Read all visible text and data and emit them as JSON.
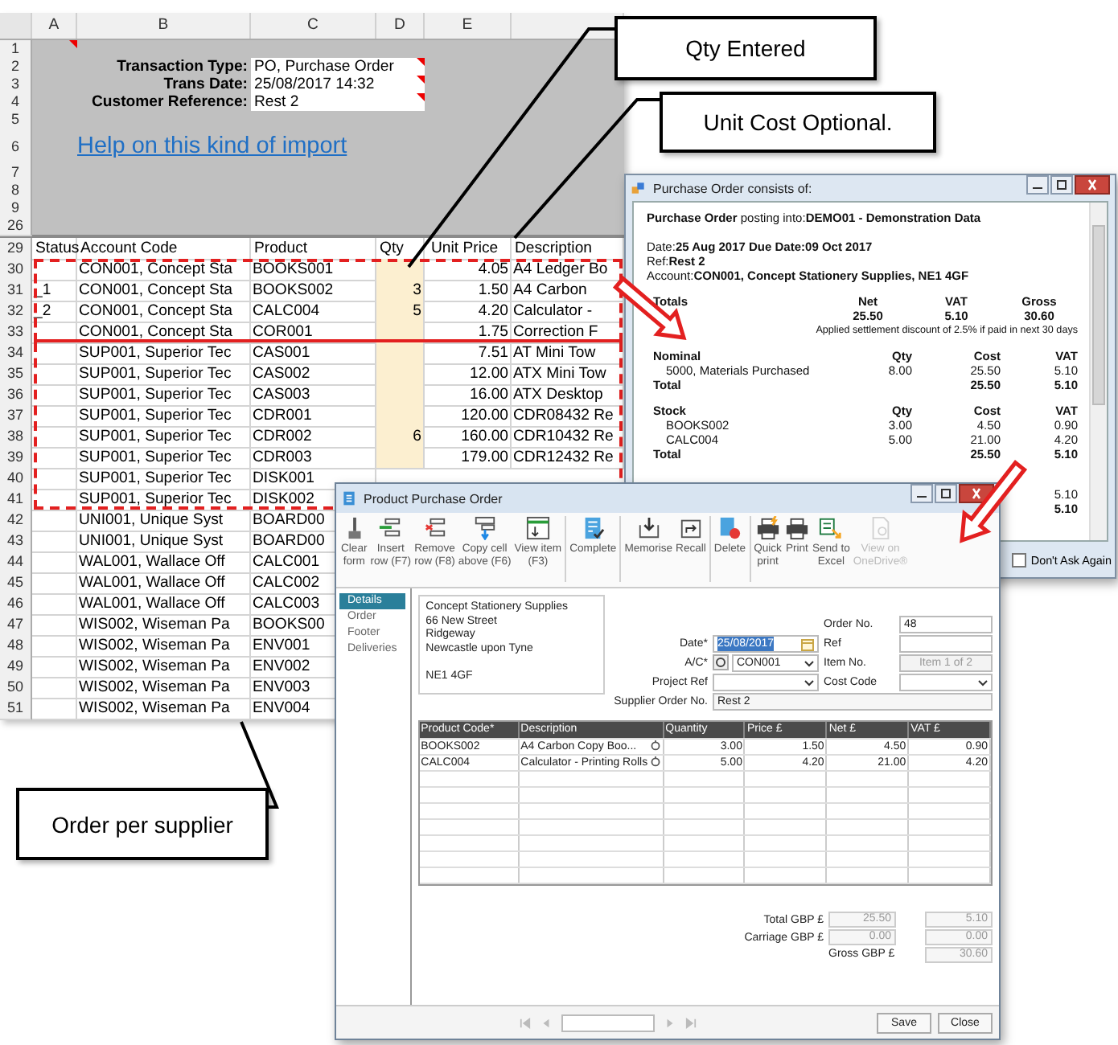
{
  "callouts": [
    "Qty Entered",
    "Unit Cost Optional.",
    "Order per supplier"
  ],
  "spreadsheet": {
    "columns": [
      "A",
      "B",
      "C",
      "D",
      "E"
    ],
    "top_rows": [
      {
        "number": "1",
        "comment": true
      },
      {
        "number": "2",
        "label": "Transaction Type:",
        "value": "PO, Purchase Order",
        "comment": true
      },
      {
        "number": "3",
        "label": "Trans Date:",
        "value": "25/08/2017 14:32",
        "comment": true
      },
      {
        "number": "4",
        "label": "Customer Reference:",
        "value": "Rest 2",
        "comment": true
      },
      {
        "number": "5"
      },
      {
        "number": "6",
        "link": "Help on this kind of import"
      },
      {
        "number": "7"
      },
      {
        "number": "8"
      },
      {
        "number": "9"
      },
      {
        "number": "26"
      }
    ],
    "header_row": {
      "number": "29",
      "cells": [
        "Status",
        "Account Code",
        "Product",
        "Qty",
        "Unit Price",
        "Description"
      ]
    },
    "rows": [
      {
        "number": "30",
        "account": "CON001, Concept Sta",
        "product": "BOOKS001",
        "unit_price": "4.05",
        "description": "A4 Ledger Bo"
      },
      {
        "number": "31",
        "status": "_1",
        "account": "CON001, Concept Sta",
        "product": "BOOKS002",
        "qty": "3",
        "unit_price": "1.50",
        "description": "A4 Carbon"
      },
      {
        "number": "32",
        "status": "_2",
        "account": "CON001, Concept Sta",
        "product": "CALC004",
        "qty": "5",
        "unit_price": "4.20",
        "description": "Calculator -"
      },
      {
        "number": "33",
        "account": "CON001, Concept Sta",
        "product": "COR001",
        "unit_price": "1.75",
        "description": "Correction F"
      },
      {
        "number": "34",
        "account": "SUP001, Superior Tec",
        "product": "CAS001",
        "unit_price": "7.51",
        "description": "AT Mini Tow"
      },
      {
        "number": "35",
        "account": "SUP001, Superior Tec",
        "product": "CAS002",
        "unit_price": "12.00",
        "description": "ATX Mini Tow"
      },
      {
        "number": "36",
        "account": "SUP001, Superior Tec",
        "product": "CAS003",
        "unit_price": "16.00",
        "description": "ATX Desktop"
      },
      {
        "number": "37",
        "account": "SUP001, Superior Tec",
        "product": "CDR001",
        "unit_price": "120.00",
        "description": "CDR08432 Re"
      },
      {
        "number": "38",
        "account": "SUP001, Superior Tec",
        "product": "CDR002",
        "qty": "6",
        "unit_price": "160.00",
        "description": "CDR10432 Re"
      },
      {
        "number": "39",
        "account": "SUP001, Superior Tec",
        "product": "CDR003",
        "unit_price": "179.00",
        "description": "CDR12432 Re"
      },
      {
        "number": "40",
        "account": "SUP001, Superior Tec",
        "product": "DISK001"
      },
      {
        "number": "41",
        "account": "SUP001, Superior Tec",
        "product": "DISK002"
      },
      {
        "number": "42",
        "account": "UNI001, Unique Syst",
        "product": "BOARD00"
      },
      {
        "number": "43",
        "account": "UNI001, Unique Syst",
        "product": "BOARD00"
      },
      {
        "number": "44",
        "account": "WAL001, Wallace Off",
        "product": "CALC001"
      },
      {
        "number": "45",
        "account": "WAL001, Wallace Off",
        "product": "CALC002"
      },
      {
        "number": "46",
        "account": "WAL001, Wallace Off",
        "product": "CALC003"
      },
      {
        "number": "47",
        "account": "WIS002, Wiseman Pa",
        "product": "BOOKS00"
      },
      {
        "number": "48",
        "account": "WIS002, Wiseman Pa",
        "product": "ENV001"
      },
      {
        "number": "49",
        "account": "WIS002, Wiseman Pa",
        "product": "ENV002"
      },
      {
        "number": "50",
        "account": "WIS002, Wiseman Pa",
        "product": "ENV003"
      },
      {
        "number": "51",
        "account": "WIS002, Wiseman Pa",
        "product": "ENV004"
      }
    ]
  },
  "po_dialog": {
    "title": "Purchase Order consists of:",
    "heading": "**Purchase Order** posting into:**DEMO01 - Demonstration Data**",
    "date_line": "Date:**25 Aug 2017 Due Date:09 Oct 2017**",
    "ref_line": "Ref:**Rest 2**",
    "account_line": "Account:**CON001, Concept Stationery Supplies, NE1 4GF**",
    "totals": {
      "label": "Totals",
      "headers": [
        "Net",
        "VAT",
        "Gross"
      ],
      "values": [
        "25.50",
        "5.10",
        "30.60"
      ],
      "note": "Applied settlement discount of 2.5% if paid in next 30 days"
    },
    "sections": [
      {
        "title": "Nominal",
        "headers": [
          "Qty",
          "Cost",
          "VAT"
        ],
        "rows": [
          {
            "name": "5000, Materials Purchased",
            "qty": "8.00",
            "cost": "25.50",
            "vat": "5.10"
          }
        ],
        "total": {
          "label": "Total",
          "cost": "25.50",
          "vat": "5.10"
        }
      },
      {
        "title": "Stock",
        "headers": [
          "Qty",
          "Cost",
          "VAT"
        ],
        "rows": [
          {
            "name": "BOOKS002",
            "qty": "3.00",
            "cost": "4.50",
            "vat": "0.90"
          },
          {
            "name": "CALC004",
            "qty": "5.00",
            "cost": "21.00",
            "vat": "4.20"
          }
        ],
        "total": {
          "label": "Total",
          "cost": "25.50",
          "vat": "5.10"
        }
      },
      {
        "rows": [
          {
            "vat": "5.10"
          }
        ],
        "total": {
          "vat": "5.10"
        }
      }
    ],
    "dont_ask_again": {
      "label": "Don't Ask Again",
      "checked": false
    }
  },
  "product_window": {
    "title": "Product Purchase Order",
    "toolbar_groups": [
      [
        {
          "lines": [
            "Clear",
            "form"
          ],
          "disabled": false
        },
        {
          "lines": [
            "Insert",
            "row (F7)"
          ],
          "disabled": false
        },
        {
          "lines": [
            "Remove",
            "row (F8)"
          ],
          "disabled": false
        },
        {
          "lines": [
            "Copy cell",
            "above (F6)"
          ],
          "disabled": false
        },
        {
          "lines": [
            "View item",
            "(F3)"
          ],
          "disabled": false
        }
      ],
      [
        {
          "lines": [
            "Complete"
          ],
          "disabled": false
        }
      ],
      [
        {
          "lines": [
            "Memorise"
          ],
          "disabled": false
        },
        {
          "lines": [
            "Recall"
          ],
          "disabled": false
        }
      ],
      [
        {
          "lines": [
            "Delete"
          ],
          "disabled": false
        }
      ],
      [
        {
          "lines": [
            "Quick",
            "print"
          ],
          "disabled": false
        },
        {
          "lines": [
            "Print"
          ],
          "disabled": false
        },
        {
          "lines": [
            "Send to",
            "Excel"
          ],
          "disabled": false
        },
        {
          "lines": [
            "View on",
            "OneDrive®"
          ],
          "disabled": true
        }
      ]
    ],
    "nav": [
      {
        "label": "Details",
        "selected": true
      },
      {
        "label": "Order",
        "selected": false
      },
      {
        "label": "Footer",
        "selected": false
      },
      {
        "label": "Deliveries",
        "selected": false
      }
    ],
    "address": [
      "Concept Stationery Supplies",
      "66 New Street",
      "Ridgeway",
      "Newcastle upon Tyne"
    ],
    "postcode": "NE1 4GF",
    "form": {
      "order_no": {
        "label": "Order No.",
        "value": "48"
      },
      "date": {
        "label": "Date*",
        "value": "25/08/2017",
        "selected": true
      },
      "ref": {
        "label": "Ref"
      },
      "account": {
        "label": "A/C*",
        "value": "CON001"
      },
      "item_no": {
        "label": "Item No.",
        "value": "Item 1 of 2",
        "disabled": true
      },
      "project_ref": {
        "label": "Project Ref"
      },
      "cost_code": {
        "label": "Cost Code"
      },
      "supplier_order_no": {
        "label": "Supplier Order No.",
        "value": "Rest 2"
      }
    },
    "grid": {
      "columns": [
        "Product Code*",
        "Description",
        "Quantity",
        "Price £",
        "Net £",
        "VAT £"
      ],
      "rows": [
        {
          "cells": [
            "BOOKS002",
            "A4 Carbon Copy Boo...",
            "3.00",
            "1.50",
            "4.50",
            "0.90"
          ]
        },
        {
          "cells": [
            "CALC004",
            "Calculator - Printing Rolls",
            "5.00",
            "4.20",
            "21.00",
            "4.20"
          ]
        }
      ]
    },
    "totals": {
      "total": {
        "label": "Total GBP £",
        "net": "25.50",
        "vat": "5.10"
      },
      "carriage": {
        "label": "Carriage GBP £",
        "net": "0.00",
        "vat": "0.00"
      },
      "gross": {
        "label": "Gross GBP £",
        "value": "30.60"
      }
    },
    "footer_buttons": [
      "Save",
      "Close"
    ]
  }
}
